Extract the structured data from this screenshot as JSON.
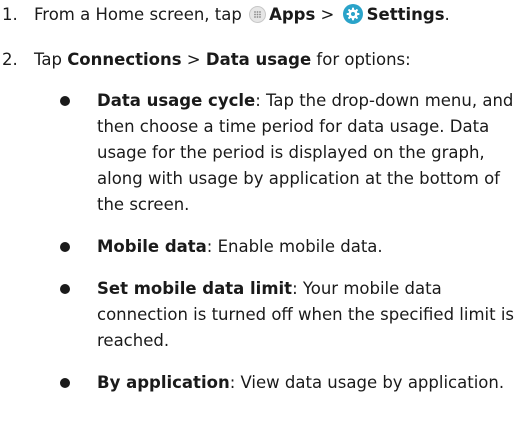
{
  "steps": [
    {
      "number": "1.",
      "prefix": "From a Home screen, tap ",
      "apps_label": "Apps",
      "separator": " > ",
      "settings_label": "Settings",
      "suffix": "."
    },
    {
      "number": "2.",
      "prefix": "Tap ",
      "connections_label": "Connections",
      "separator": " > ",
      "data_usage_label": "Data usage",
      "suffix": " for options:"
    }
  ],
  "options": [
    {
      "term": "Data usage cycle",
      "desc": ": Tap the drop-down menu, and then choose a time period for data usage. Data usage for the period is displayed on the graph, along with usage by application at the bottom of the screen."
    },
    {
      "term": "Mobile data",
      "desc": ": Enable mobile data."
    },
    {
      "term": "Set mobile data limit",
      "desc": ": Your mobile data connection is turned off when the specified limit is reached."
    },
    {
      "term": "By application",
      "desc": ": View data usage by application."
    }
  ],
  "icons": {
    "apps": "apps-grid-icon",
    "settings": "settings-gear-icon",
    "settings_color": "#2aa3c9"
  }
}
